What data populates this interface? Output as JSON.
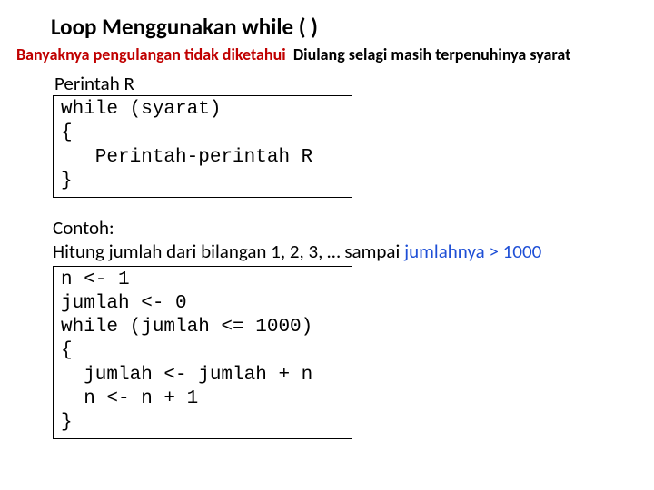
{
  "title": "Loop Menggunakan while ( )",
  "subtitle": {
    "lead": "Banyaknya pengulangan tidak diketahui",
    "trail": "Diulang selagi masih terpenuhinya syarat"
  },
  "label1": "Perintah R",
  "code1": "while (syarat)\n{\n   Perintah-perintah R\n}",
  "contoh": {
    "line1": "Contoh:",
    "line2a": "Hitung jumlah dari bilangan 1, 2, 3, … sampai ",
    "line2b": "jumlahnya > 1000"
  },
  "code2": "n <- 1\njumlah <- 0\nwhile (jumlah <= 1000)\n{\n  jumlah <- jumlah + n\n  n <- n + 1\n}"
}
